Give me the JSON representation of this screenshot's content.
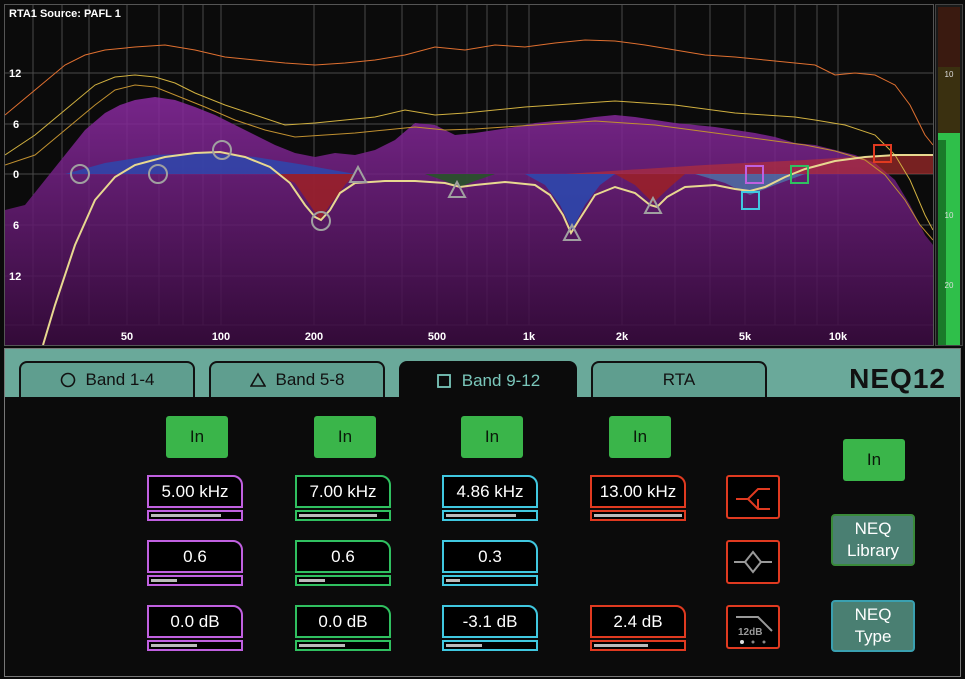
{
  "rta": {
    "title": "RTA1 Source: PAFL 1"
  },
  "graph": {
    "y_labels": [
      "12",
      "6",
      "0",
      "6",
      "12"
    ],
    "x_labels": [
      "50",
      "100",
      "200",
      "500",
      "1k",
      "2k",
      "5k",
      "10k"
    ]
  },
  "meter": {
    "scale": [
      "10",
      "10",
      "20"
    ]
  },
  "tabs": [
    {
      "label": "Band 1-4",
      "icon": "circle-icon"
    },
    {
      "label": "Band 5-8",
      "icon": "triangle-icon"
    },
    {
      "label": "Band 9-12",
      "icon": "square-icon"
    },
    {
      "label": "RTA",
      "icon": ""
    }
  ],
  "logo": {
    "text": "NEQ",
    "num": "12"
  },
  "bands": [
    {
      "in": "In",
      "freq": "5.00 kHz",
      "q": "0.6",
      "gain": "0.0 dB",
      "color": "#c060e0",
      "freq_fill": 0.78,
      "q_fill": 0.3,
      "gain_fill": 0.5
    },
    {
      "in": "In",
      "freq": "7.00 kHz",
      "q": "0.6",
      "gain": "0.0 dB",
      "color": "#30c060",
      "freq_fill": 0.84,
      "q_fill": 0.3,
      "gain_fill": 0.5
    },
    {
      "in": "In",
      "freq": "4.86 kHz",
      "q": "0.3",
      "gain": "-3.1 dB",
      "color": "#40c8e0",
      "freq_fill": 0.78,
      "q_fill": 0.15,
      "gain_fill": 0.4
    },
    {
      "in": "In",
      "freq": "13.00 kHz",
      "gain": "2.4 dB",
      "color": "#e03a20",
      "freq_fill": 0.96,
      "gain_fill": 0.58
    }
  ],
  "filter_buttons": {
    "slope_label": "12dB"
  },
  "master": {
    "in": "In",
    "library_line1": "NEQ",
    "library_line2": "Library",
    "type_line1": "NEQ",
    "type_line2": "Type"
  }
}
